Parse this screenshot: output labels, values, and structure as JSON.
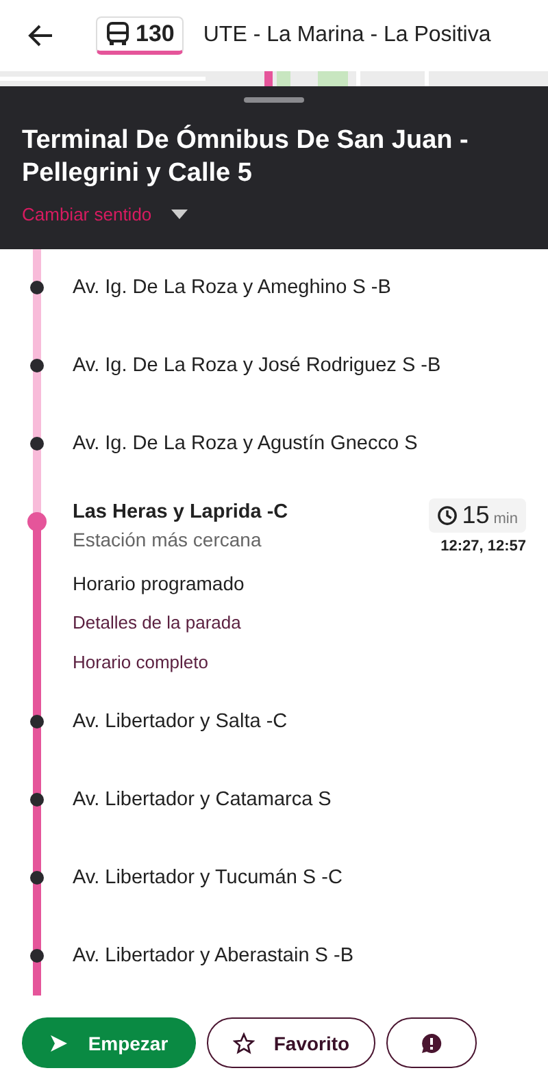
{
  "header": {
    "route_number": "130",
    "route_name": "UTE - La Marina - La Positiva"
  },
  "sheet": {
    "title": "Terminal De Ómnibus De San Juan - Pellegrini y Calle 5",
    "direction_link": "Cambiar sentido"
  },
  "stops": [
    {
      "name": "Av. Ig. De La Roza y Ameghino S -B",
      "selected": false
    },
    {
      "name": "Av. Ig. De La Roza y José Rodriguez S -B",
      "selected": false
    },
    {
      "name": "Av. Ig. De La Roza y Agustín Gnecco S",
      "selected": false
    },
    {
      "name": "Las Heras y Laprida -C",
      "selected": true,
      "subtitle": "Estación más cercana",
      "eta": "15",
      "eta_unit": "min",
      "times": "12:27, 12:57",
      "schedule_label": "Horario programado",
      "links": [
        "Detalles de la parada",
        "Horario completo"
      ]
    },
    {
      "name": "Av. Libertador y Salta -C",
      "selected": false
    },
    {
      "name": "Av. Libertador y Catamarca S",
      "selected": false
    },
    {
      "name": "Av. Libertador y Tucumán S -C",
      "selected": false
    },
    {
      "name": "Av. Libertador y Aberastain S -B",
      "selected": false
    }
  ],
  "actions": {
    "start": "Empezar",
    "favorite": "Favorito"
  }
}
